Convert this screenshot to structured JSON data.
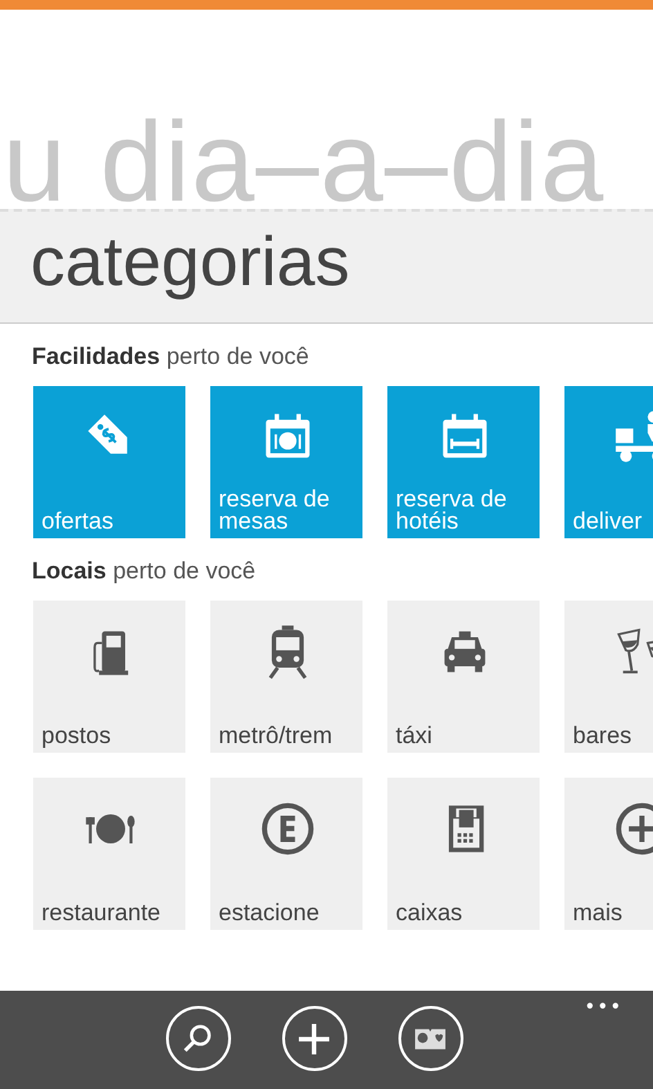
{
  "background_title": "u dia–a–dia",
  "page_title": "categorias",
  "sections": [
    {
      "title": "Facilidades",
      "subtitle": "perto de você",
      "rows": [
        [
          {
            "label": "ofertas",
            "kind": "tag"
          },
          {
            "label": "reserva de mesas",
            "kind": "table"
          },
          {
            "label": "reserva de hotéis",
            "kind": "hotel"
          },
          {
            "label": "deliver",
            "kind": "delivery"
          }
        ]
      ]
    },
    {
      "title": "Locais",
      "subtitle": "perto de você",
      "rows": [
        [
          {
            "label": "postos",
            "kind": "fuel"
          },
          {
            "label": "metrô/trem",
            "kind": "train"
          },
          {
            "label": "táxi",
            "kind": "taxi"
          },
          {
            "label": "bares",
            "kind": "bar"
          }
        ],
        [
          {
            "label": "restaurante",
            "kind": "restaurant"
          },
          {
            "label": "estacione",
            "kind": "parking"
          },
          {
            "label": "caixas",
            "kind": "atm"
          },
          {
            "label": "mais",
            "kind": "more"
          }
        ]
      ]
    }
  ],
  "app_bar": {
    "more": "•••"
  }
}
